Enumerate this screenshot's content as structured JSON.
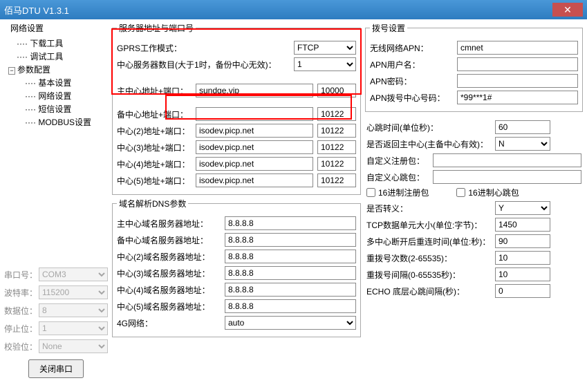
{
  "title": "佰马DTU V1.3.1",
  "tree_group": "网络设置",
  "tree": {
    "download": "下载工具",
    "debug": "调试工具",
    "params": "参数配置",
    "basic": "基本设置",
    "network": "网络设置",
    "sms": "短信设置",
    "modbus": "MODBUS设置"
  },
  "serial": {
    "port_label": "串口号：",
    "port": "COM3",
    "baud_label": "波特率：",
    "baud": "115200",
    "data_label": "数据位：",
    "data": "8",
    "stop_label": "停止位：",
    "stop": "1",
    "parity_label": "校验位：",
    "parity": "None",
    "close_btn": "关闭串口"
  },
  "server": {
    "legend": "服务器地址与端口号",
    "mode_label": "GPRS工作模式：",
    "mode": "FTCP",
    "count_label": "中心服务器数目(大于1时，备份中心无效)：",
    "count": "1",
    "main_label": "主中心地址+端口：",
    "main_addr": "sundge.vip",
    "main_port": "10000",
    "bak_label": "备中心地址+端口：",
    "bak_addr": "",
    "bak_port": "10122",
    "c2_label": "中心(2)地址+端口：",
    "c2_addr": "isodev.picp.net",
    "c2_port": "10122",
    "c3_label": "中心(3)地址+端口：",
    "c3_addr": "isodev.picp.net",
    "c3_port": "10122",
    "c4_label": "中心(4)地址+端口：",
    "c4_addr": "isodev.picp.net",
    "c4_port": "10122",
    "c5_label": "中心(5)地址+端口：",
    "c5_addr": "isodev.picp.net",
    "c5_port": "10122"
  },
  "dns": {
    "legend": "域名解析DNS参数",
    "main": "主中心域名服务器地址：",
    "bak": "备中心域名服务器地址：",
    "d2": "中心(2)域名服务器地址：",
    "d3": "中心(3)域名服务器地址：",
    "d4": "中心(4)域名服务器地址：",
    "d5": "中心(5)域名服务器地址：",
    "val": "8.8.8.8",
    "net4g_label": "4G网络：",
    "net4g": "auto"
  },
  "dial": {
    "legend": "拨号设置",
    "apn_label": "无线网络APN：",
    "apn": "cmnet",
    "user_label": "APN用户名：",
    "user": "",
    "pwd_label": "APN密码：",
    "pwd": "",
    "center_label": "APN拨号中心号码：",
    "center": "*99***1#"
  },
  "adv": {
    "heartbeat_label": "心跳时间(单位秒)：",
    "heartbeat": "60",
    "return_label": "是否返回主中心(主备中心有效)：",
    "return": "N",
    "reg_label": "自定义注册包：",
    "reg": "",
    "hb_label": "自定义心跳包：",
    "hb": "",
    "hex_reg": "16进制注册包",
    "hex_hb": "16进制心跳包",
    "escape_label": "是否转义：",
    "escape": "Y",
    "mtu_label": "TCP数据单元大小(单位:字节)：",
    "mtu": "1450",
    "reconnect_label": "多中心断开后重连时间(单位:秒)：",
    "reconnect": "90",
    "redial_label": "重拨号次数(2-65535)：",
    "redial": "10",
    "interval_label": "重拨号间隔(0-65535秒)：",
    "interval": "10",
    "echo_label": "ECHO 底层心跳间隔(秒)：",
    "echo": "0"
  }
}
